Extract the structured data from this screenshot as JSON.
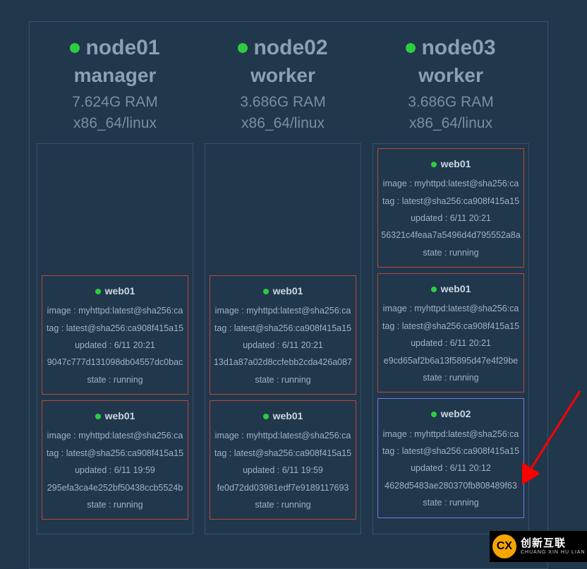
{
  "nodes": [
    {
      "name": "node01",
      "role": "manager",
      "ram": "7.624G RAM",
      "arch": "x86_64/linux",
      "leading_space": true,
      "containers": [
        {
          "style": "red",
          "title": "web01",
          "image": "image : myhttpd:latest@sha256:ca",
          "tag": "tag : latest@sha256:ca908f415a15",
          "updated": "updated : 6/11 20:21",
          "id": "9047c777d131098db04557dc0bac",
          "state": "state : running"
        },
        {
          "style": "red",
          "title": "web01",
          "image": "image : myhttpd:latest@sha256:ca",
          "tag": "tag : latest@sha256:ca908f415a15",
          "updated": "updated : 6/11 19:59",
          "id": "295efa3ca4e252bf50438ccb5524b",
          "state": "state : running"
        }
      ]
    },
    {
      "name": "node02",
      "role": "worker",
      "ram": "3.686G RAM",
      "arch": "x86_64/linux",
      "leading_space": true,
      "containers": [
        {
          "style": "red",
          "title": "web01",
          "image": "image : myhttpd:latest@sha256:ca",
          "tag": "tag : latest@sha256:ca908f415a15",
          "updated": "updated : 6/11 20:21",
          "id": "13d1a87a02d8ccfebb2cda426a087",
          "state": "state : running"
        },
        {
          "style": "red",
          "title": "web01",
          "image": "image : myhttpd:latest@sha256:ca",
          "tag": "tag : latest@sha256:ca908f415a15",
          "updated": "updated : 6/11 19:59",
          "id": "fe0d72dd03981edf7e9189117693",
          "state": "state : running"
        }
      ]
    },
    {
      "name": "node03",
      "role": "worker",
      "ram": "3.686G RAM",
      "arch": "x86_64/linux",
      "leading_space": false,
      "containers": [
        {
          "style": "red",
          "title": "web01",
          "image": "image : myhttpd:latest@sha256:ca",
          "tag": "tag : latest@sha256:ca908f415a15",
          "updated": "updated : 6/11 20:21",
          "id": "56321c4feaa7a5496d4d795552a8a",
          "state": "state : running"
        },
        {
          "style": "red",
          "title": "web01",
          "image": "image : myhttpd:latest@sha256:ca",
          "tag": "tag : latest@sha256:ca908f415a15",
          "updated": "updated : 6/11 20:21",
          "id": "e9cd65af2b6a13f5895d47e4f29be",
          "state": "state : running"
        },
        {
          "style": "blue",
          "title": "web02",
          "image": "image : myhttpd:latest@sha256:ca",
          "tag": "tag : latest@sha256:ca908f415a15",
          "updated": "updated : 6/11 20:12",
          "id": "4628d5483ae280370fb808489f63",
          "state": "state : running"
        }
      ]
    }
  ],
  "watermark": {
    "zh": "创新互联",
    "pinyin": "CHUANG XIN HU LIAN",
    "logo": "CX"
  }
}
